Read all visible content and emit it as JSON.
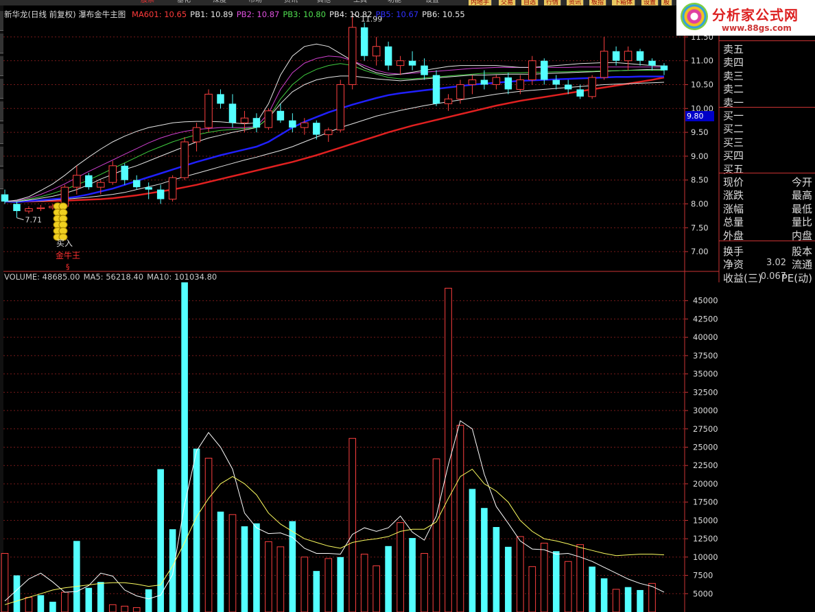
{
  "window": {
    "menu": [
      "股票",
      "基化",
      "深度",
      "市场",
      "资讯",
      "其他",
      "工具",
      "功能",
      "设置"
    ],
    "quick_buttons": [
      "内地手",
      "交易",
      "自选",
      "行情",
      "资讯",
      "板指",
      "下箱体",
      "设置",
      "股"
    ],
    "left_tabs": 8,
    "logo": {
      "name": "分析家公式网",
      "url_text": "www.88gs.com"
    }
  },
  "legend": {
    "title": "新华龙(日线 前复权) 瀑布金牛主图",
    "items": [
      {
        "label": "MA601: 10.65",
        "color": "#ff3b3b"
      },
      {
        "label": "PB1: 10.89",
        "color": "#e8e8e8"
      },
      {
        "label": "PB2: 10.87",
        "color": "#e050e0"
      },
      {
        "label": "PB3: 10.80",
        "color": "#50e050"
      },
      {
        "label": "PB4: 10.82",
        "color": "#e8e8e8"
      },
      {
        "label": "PB5: 10.67",
        "color": "#3030ff"
      },
      {
        "label": "PB6: 10.55",
        "color": "#e8e8e8"
      }
    ]
  },
  "annotations": {
    "high_label": "11.99",
    "low_label": "7.71",
    "buy_label": "买入",
    "signal_label": "金牛王",
    "marker_glyph": "§",
    "price_tag": "9.80"
  },
  "volume_legend": {
    "items": [
      {
        "label": "VOLUME: 48685.00",
        "color": "#cccccc"
      },
      {
        "label": "MA5: 56218.40",
        "color": "#cccccc"
      },
      {
        "label": "MA10: 101034.80",
        "color": "#cccccc"
      }
    ]
  },
  "quote_panel": {
    "ask": [
      "卖五",
      "卖四",
      "卖三",
      "卖二",
      "卖一"
    ],
    "bid": [
      "买一",
      "买二",
      "买三",
      "买四",
      "买五"
    ],
    "stats": [
      {
        "left": "现价",
        "right": "今开",
        "value": ""
      },
      {
        "left": "涨跌",
        "right": "最高",
        "value": ""
      },
      {
        "left": "涨幅",
        "right": "最低",
        "value": ""
      },
      {
        "left": "总量",
        "right": "量比",
        "value": ""
      },
      {
        "left": "外盘",
        "right": "内盘",
        "value": ""
      },
      {
        "left": "换手",
        "right": "股本",
        "value": ""
      },
      {
        "left": "净资",
        "right": "流通",
        "value": "3.02"
      },
      {
        "left": "收益(三)",
        "right": "PE(动)",
        "value": "0.067"
      }
    ]
  },
  "chart_data": [
    {
      "type": "candlestick",
      "title": "新华龙(日线 前复权) 瀑布金牛主图",
      "y_ticks": [
        7.0,
        7.5,
        8.0,
        8.5,
        9.0,
        9.5,
        10.0,
        10.5,
        11.0,
        11.5
      ],
      "ylim": [
        6.6,
        11.9
      ],
      "grid": true,
      "highest": 11.99,
      "lowest": 7.71,
      "series": [
        {
          "name": "MA601",
          "color": "#e02020",
          "width": 2.5,
          "values": [
            8.05,
            8.05,
            8.05,
            8.06,
            8.06,
            8.07,
            8.08,
            8.09,
            8.1,
            8.12,
            8.15,
            8.18,
            8.22,
            8.26,
            8.3,
            8.35,
            8.4,
            8.46,
            8.52,
            8.58,
            8.64,
            8.7,
            8.76,
            8.82,
            8.88,
            8.95,
            9.02,
            9.1,
            9.18,
            9.26,
            9.34,
            9.42,
            9.5,
            9.57,
            9.64,
            9.7,
            9.76,
            9.82,
            9.88,
            9.94,
            10.0,
            10.06,
            10.11,
            10.16,
            10.2,
            10.24,
            10.28,
            10.32,
            10.36,
            10.4,
            10.44,
            10.48,
            10.52,
            10.56,
            10.6,
            10.65
          ]
        },
        {
          "name": "PB6",
          "color": "#e8e8e8",
          "width": 1,
          "values": [
            8.05,
            8.04,
            8.05,
            8.06,
            8.08,
            8.1,
            8.12,
            8.14,
            8.17,
            8.2,
            8.24,
            8.3,
            8.36,
            8.42,
            8.5,
            8.57,
            8.64,
            8.71,
            8.78,
            8.85,
            8.92,
            8.98,
            9.05,
            9.12,
            9.2,
            9.3,
            9.4,
            9.5,
            9.6,
            9.68,
            9.76,
            9.84,
            9.9,
            9.96,
            10.01,
            10.06,
            10.1,
            10.14,
            10.18,
            10.22,
            10.26,
            10.3,
            10.33,
            10.36,
            10.38,
            10.4,
            10.42,
            10.44,
            10.46,
            10.48,
            10.5,
            10.51,
            10.52,
            10.53,
            10.54,
            10.55
          ]
        },
        {
          "name": "PB5",
          "color": "#2020ff",
          "width": 2.5,
          "values": [
            8.05,
            8.04,
            8.06,
            8.08,
            8.1,
            8.12,
            8.15,
            8.2,
            8.26,
            8.32,
            8.4,
            8.48,
            8.56,
            8.64,
            8.72,
            8.8,
            8.88,
            8.95,
            9.02,
            9.08,
            9.14,
            9.2,
            9.3,
            9.45,
            9.6,
            9.72,
            9.82,
            9.92,
            10.0,
            10.08,
            10.15,
            10.22,
            10.28,
            10.32,
            10.35,
            10.38,
            10.41,
            10.44,
            10.47,
            10.5,
            10.52,
            10.54,
            10.56,
            10.58,
            10.59,
            10.6,
            10.61,
            10.62,
            10.63,
            10.64,
            10.65,
            10.66,
            10.66,
            10.67,
            10.67,
            10.67
          ]
        },
        {
          "name": "PB4",
          "color": "#e8e8e8",
          "width": 1,
          "values": [
            8.05,
            8.05,
            8.08,
            8.12,
            8.16,
            8.22,
            8.3,
            8.4,
            8.52,
            8.62,
            8.72,
            8.8,
            8.9,
            9.0,
            9.1,
            9.2,
            9.3,
            9.38,
            9.44,
            9.5,
            9.55,
            9.6,
            9.8,
            10.1,
            10.35,
            10.5,
            10.6,
            10.65,
            10.68,
            10.68,
            10.65,
            10.62,
            10.6,
            10.58,
            10.6,
            10.62,
            10.64,
            10.66,
            10.68,
            10.7,
            10.7,
            10.71,
            10.72,
            10.72,
            10.72,
            10.73,
            10.74,
            10.75,
            10.76,
            10.77,
            10.78,
            10.79,
            10.8,
            10.81,
            10.82,
            10.82
          ]
        },
        {
          "name": "PB3",
          "color": "#40d040",
          "width": 1,
          "values": [
            8.05,
            8.06,
            8.1,
            8.15,
            8.22,
            8.3,
            8.4,
            8.5,
            8.62,
            8.74,
            8.86,
            8.98,
            9.1,
            9.2,
            9.3,
            9.38,
            9.45,
            9.5,
            9.54,
            9.56,
            9.58,
            9.6,
            9.8,
            10.2,
            10.5,
            10.7,
            10.82,
            10.9,
            10.94,
            10.9,
            10.8,
            10.72,
            10.65,
            10.62,
            10.62,
            10.64,
            10.66,
            10.68,
            10.7,
            10.72,
            10.74,
            10.74,
            10.75,
            10.75,
            10.76,
            10.76,
            10.77,
            10.77,
            10.78,
            10.78,
            10.79,
            10.79,
            10.8,
            10.8,
            10.8,
            10.8
          ]
        },
        {
          "name": "PB2",
          "color": "#d040d0",
          "width": 1,
          "values": [
            8.05,
            8.07,
            8.12,
            8.2,
            8.3,
            8.42,
            8.55,
            8.68,
            8.8,
            8.92,
            9.04,
            9.16,
            9.28,
            9.38,
            9.46,
            9.52,
            9.56,
            9.58,
            9.6,
            9.6,
            9.6,
            9.62,
            9.9,
            10.4,
            10.75,
            10.95,
            11.05,
            11.1,
            11.08,
            11.0,
            10.9,
            10.8,
            10.74,
            10.72,
            10.74,
            10.76,
            10.78,
            10.8,
            10.82,
            10.84,
            10.85,
            10.86,
            10.86,
            10.86,
            10.86,
            10.86,
            10.86,
            10.86,
            10.87,
            10.87,
            10.87,
            10.87,
            10.87,
            10.87,
            10.87,
            10.87
          ]
        },
        {
          "name": "PB1",
          "color": "#e8e8e8",
          "width": 1,
          "values": [
            8.05,
            8.08,
            8.15,
            8.28,
            8.42,
            8.6,
            8.8,
            8.98,
            9.15,
            9.3,
            9.42,
            9.52,
            9.6,
            9.65,
            9.7,
            9.72,
            9.73,
            9.73,
            9.72,
            9.7,
            9.68,
            9.7,
            10.1,
            10.7,
            11.1,
            11.3,
            11.35,
            11.3,
            11.15,
            11.0,
            10.85,
            10.75,
            10.7,
            10.72,
            10.76,
            10.8,
            10.84,
            10.88,
            10.9,
            10.9,
            10.9,
            10.9,
            10.88,
            10.86,
            10.86,
            10.88,
            10.9,
            10.92,
            10.94,
            10.95,
            10.96,
            10.96,
            10.94,
            10.92,
            10.9,
            10.89
          ]
        }
      ],
      "candles_note": "56 daily candles (open, high, low, close)",
      "candles": [
        [
          8.2,
          8.3,
          8.0,
          8.05
        ],
        [
          8.0,
          8.05,
          7.71,
          7.85
        ],
        [
          7.85,
          7.95,
          7.8,
          7.9
        ],
        [
          7.9,
          7.98,
          7.85,
          7.92
        ],
        [
          7.92,
          8.0,
          7.88,
          7.95
        ],
        [
          7.95,
          8.4,
          7.95,
          8.35
        ],
        [
          8.35,
          8.8,
          8.2,
          8.6
        ],
        [
          8.6,
          8.65,
          8.3,
          8.35
        ],
        [
          8.35,
          8.5,
          8.2,
          8.45
        ],
        [
          8.45,
          8.9,
          8.4,
          8.8
        ],
        [
          8.8,
          8.85,
          8.4,
          8.5
        ],
        [
          8.5,
          8.6,
          8.3,
          8.35
        ],
        [
          8.35,
          8.45,
          8.1,
          8.3
        ],
        [
          8.3,
          8.4,
          8.0,
          8.1
        ],
        [
          8.1,
          8.6,
          8.05,
          8.55
        ],
        [
          8.55,
          9.4,
          8.5,
          9.3
        ],
        [
          9.3,
          9.7,
          9.1,
          9.6
        ],
        [
          9.6,
          10.4,
          9.5,
          10.3
        ],
        [
          10.3,
          10.4,
          10.0,
          10.1
        ],
        [
          10.1,
          10.3,
          9.6,
          9.7
        ],
        [
          9.7,
          9.95,
          9.5,
          9.8
        ],
        [
          9.8,
          9.9,
          9.5,
          9.6
        ],
        [
          9.6,
          10.0,
          9.55,
          9.95
        ],
        [
          9.95,
          10.1,
          9.7,
          9.75
        ],
        [
          9.75,
          9.9,
          9.5,
          9.6
        ],
        [
          9.6,
          9.8,
          9.45,
          9.7
        ],
        [
          9.7,
          9.75,
          9.35,
          9.45
        ],
        [
          9.45,
          9.6,
          9.3,
          9.55
        ],
        [
          9.55,
          10.6,
          9.5,
          10.5
        ],
        [
          10.5,
          11.99,
          10.4,
          11.7
        ],
        [
          11.7,
          11.8,
          11.0,
          11.1
        ],
        [
          11.1,
          11.5,
          10.9,
          11.3
        ],
        [
          11.3,
          11.4,
          10.8,
          10.9
        ],
        [
          10.9,
          11.1,
          10.7,
          11.0
        ],
        [
          11.0,
          11.2,
          10.8,
          10.9
        ],
        [
          10.9,
          11.05,
          10.6,
          10.7
        ],
        [
          10.7,
          10.8,
          10.05,
          10.1
        ],
        [
          10.1,
          10.3,
          9.95,
          10.2
        ],
        [
          10.2,
          10.6,
          10.1,
          10.5
        ],
        [
          10.5,
          10.7,
          10.3,
          10.6
        ],
        [
          10.6,
          10.8,
          10.4,
          10.5
        ],
        [
          10.5,
          10.7,
          10.4,
          10.65
        ],
        [
          10.65,
          10.75,
          10.3,
          10.4
        ],
        [
          10.4,
          10.7,
          10.3,
          10.6
        ],
        [
          10.6,
          11.1,
          10.5,
          11.0
        ],
        [
          11.0,
          11.05,
          10.5,
          10.6
        ],
        [
          10.6,
          10.7,
          10.4,
          10.5
        ],
        [
          10.5,
          10.6,
          10.3,
          10.4
        ],
        [
          10.4,
          10.5,
          10.2,
          10.25
        ],
        [
          10.25,
          10.7,
          10.2,
          10.65
        ],
        [
          10.65,
          11.5,
          10.6,
          11.2
        ],
        [
          11.2,
          11.3,
          10.9,
          11.0
        ],
        [
          11.0,
          11.3,
          10.8,
          11.2
        ],
        [
          11.2,
          11.25,
          10.9,
          11.0
        ],
        [
          11.0,
          11.05,
          10.8,
          10.9
        ],
        [
          10.9,
          10.95,
          10.7,
          10.8
        ]
      ]
    },
    {
      "type": "bar",
      "title": "VOLUME: 48685.00",
      "y_ticks": [
        5000,
        7500,
        10000,
        12500,
        15000,
        17500,
        20000,
        22500,
        25000,
        27500,
        30000,
        32500,
        35000,
        37500,
        40000,
        42500,
        45000
      ],
      "ylim": [
        2500,
        47500
      ],
      "grid": true,
      "values": [
        10500,
        7500,
        4500,
        4800,
        3900,
        5200,
        12200,
        5800,
        6600,
        3500,
        3300,
        3100,
        5600,
        22000,
        13800,
        47500,
        24800,
        23500,
        16200,
        15800,
        14200,
        14600,
        12100,
        11400,
        14900,
        10000,
        8100,
        9800,
        10000,
        26200,
        10400,
        8800,
        11500,
        14700,
        12600,
        10500,
        23400,
        46700,
        28000,
        19300,
        16700,
        14100,
        11400,
        12800,
        8700,
        11900,
        10800,
        9400,
        11700,
        8700,
        7100,
        5600,
        5900,
        5500,
        6400,
        2400
      ],
      "up_flags": [
        1,
        0,
        1,
        0,
        0,
        1,
        0,
        0,
        0,
        1,
        1,
        1,
        0,
        0,
        0,
        0,
        0,
        1,
        0,
        1,
        0,
        0,
        1,
        1,
        0,
        1,
        0,
        1,
        0,
        1,
        1,
        1,
        0,
        1,
        0,
        1,
        1,
        1,
        1,
        0,
        0,
        0,
        0,
        1,
        1,
        1,
        0,
        1,
        1,
        0,
        0,
        1,
        0,
        0,
        1,
        0
      ],
      "series": [
        {
          "name": "MA5",
          "color": "#ffffff",
          "values": [
            4000,
            5500,
            7000,
            7800,
            6600,
            5200,
            5300,
            6100,
            7800,
            7400,
            5500,
            4700,
            4300,
            4800,
            7600,
            17200,
            24500,
            27000,
            25000,
            22000,
            16000,
            14000,
            13200,
            13300,
            12700,
            11200,
            10500,
            10500,
            10400,
            13100,
            14000,
            13500,
            14000,
            15600,
            13400,
            12300,
            15600,
            22600,
            28600,
            27500,
            21300,
            16900,
            14600,
            12200,
            11100,
            11000,
            10400,
            10500,
            10000,
            9400,
            8600,
            7800,
            7000,
            6400,
            6000,
            5200
          ]
        },
        {
          "name": "MA10",
          "color": "#ffff60",
          "values": [
            3500,
            4000,
            4500,
            5000,
            5500,
            5800,
            6000,
            6200,
            6400,
            6500,
            6500,
            6300,
            6000,
            6200,
            8800,
            12000,
            15500,
            18000,
            20000,
            21000,
            20000,
            18500,
            16000,
            14500,
            13500,
            12500,
            12000,
            11500,
            11200,
            12000,
            12300,
            12500,
            12800,
            13500,
            13800,
            13800,
            14800,
            18000,
            21000,
            22000,
            20000,
            19000,
            17500,
            15000,
            13500,
            12500,
            12200,
            11800,
            11300,
            10900,
            10500,
            10200,
            10300,
            10400,
            10400,
            10300
          ]
        }
      ]
    }
  ]
}
